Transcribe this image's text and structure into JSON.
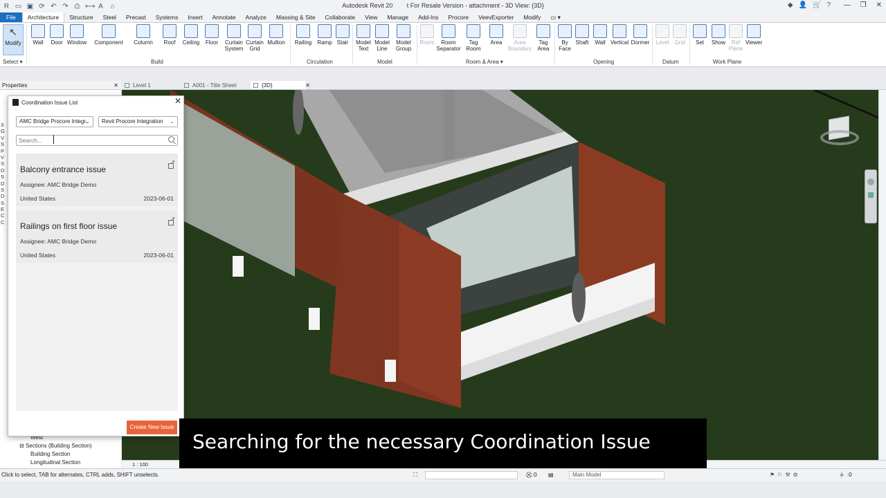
{
  "window": {
    "title": "Autodesk Revit 20__ - Not For Resale Version - attachment - 3D View: {3D}",
    "title_display": "Autodesk Revit 20   t For Resale Version - attachment - 3D View: {3D}"
  },
  "ribbon_tabs": [
    "File",
    "Architecture",
    "Structure",
    "Steel",
    "Precast",
    "Systems",
    "Insert",
    "Annotate",
    "Analyze",
    "Massing & Site",
    "Collaborate",
    "View",
    "Manage",
    "Add-Ins",
    "Procore",
    "VeevExporter",
    "Modify"
  ],
  "ribbon": {
    "select_label": "Select",
    "modify": "Modify",
    "build": [
      "Wall",
      "Door",
      "Window",
      "Component",
      "Column",
      "Roof",
      "Ceiling",
      "Floor",
      "Curtain System",
      "Curtain Grid",
      "Mullion"
    ],
    "circulation": [
      "Railing",
      "Ramp",
      "Stair"
    ],
    "model": [
      "Model Text",
      "Model Line",
      "Model Group"
    ],
    "room_area": [
      "Room",
      "Room Separator",
      "Tag Room",
      "Area",
      "Area Boundary",
      "Tag Area"
    ],
    "opening": [
      "By Face",
      "Shaft",
      "Wall",
      "Vertical",
      "Dormer"
    ],
    "datum": [
      "Level",
      "Grid"
    ],
    "work_plane": [
      "Set",
      "Show",
      "Ref Plane",
      "Viewer"
    ],
    "panels": {
      "build": "Build",
      "circulation": "Circulation",
      "model": "Model",
      "room_area": "Room & Area",
      "opening": "Opening",
      "datum": "Datum",
      "work_plane": "Work Plane"
    }
  },
  "properties": {
    "title": "Properties"
  },
  "view_tabs": [
    "Level 1",
    "A001 - Title Sheet",
    "{3D}"
  ],
  "project_tree": {
    "items": [
      "West",
      "Sections (Building Section)",
      "Building Section",
      "Longitudinal Section"
    ]
  },
  "view_bar": {
    "scale": "1 : 100"
  },
  "status": {
    "hint": "Click to select, TAB for alternates, CTRL adds, SHIFT unselects.",
    "selection_count": ":0",
    "model": "Main Model",
    "filter_count": ":0"
  },
  "dialog": {
    "title": "Coordination Issue List",
    "project_dropdown": "AMC Bridge Procore Integr.",
    "integration_dropdown": "Revit Procore Integration",
    "search_placeholder": "Search...",
    "issues": [
      {
        "title": "Balcony entrance issue",
        "assignee": "Assignee: AMC Bridge Demo",
        "location": "United States",
        "date": "2023-06-01"
      },
      {
        "title": "Railings on first floor issue",
        "assignee": "Assignee: AMC Bridge Demo",
        "location": "United States",
        "date": "2023-06-01"
      }
    ],
    "create_button": "Create New Issue"
  },
  "caption": "Searching for the necessary Coordination Issue",
  "colors": {
    "file_tab": "#1e6fc1",
    "create_button": "#e8643a",
    "wood_cladding": "#8a3a22",
    "ground": "#253a1a"
  }
}
